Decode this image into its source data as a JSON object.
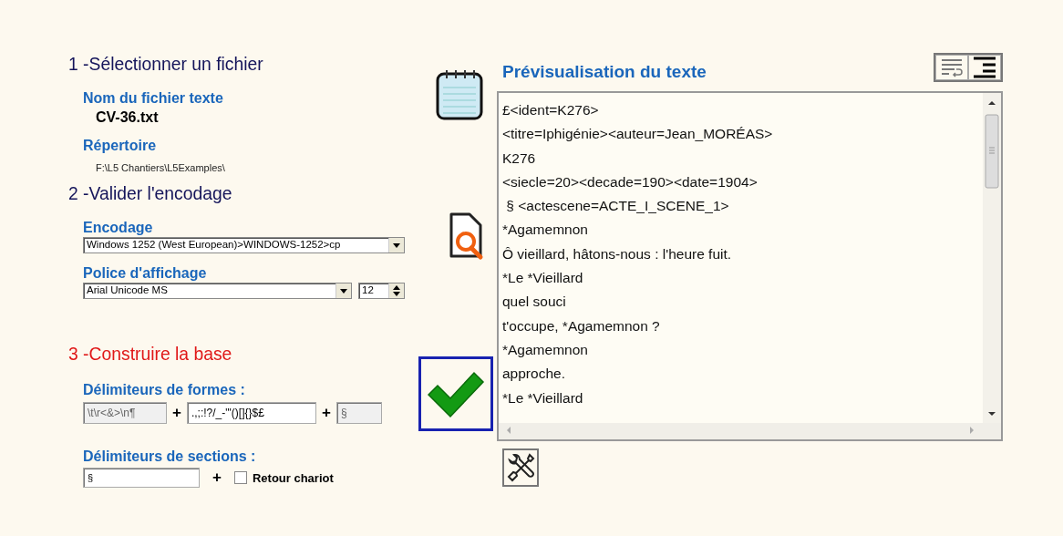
{
  "steps": [
    {
      "title": "1 -Sélectionner un fichier",
      "color": "#14145a"
    },
    {
      "title": "2 -Valider l'encodage",
      "color": "#14145a"
    },
    {
      "title": "3 -Construire la base",
      "color": "#e01818"
    }
  ],
  "file": {
    "name_label": "Nom du fichier texte",
    "name": "CV-36.txt",
    "directory_label": "Répertoire",
    "directory": "F:\\L5 Chantiers\\L5Examples\\"
  },
  "encoding": {
    "label": "Encodage",
    "value": "Windows 1252 (West European)>WINDOWS-1252>cp"
  },
  "display_font": {
    "label": "Police d'affichage",
    "value": "Arial Unicode MS",
    "size": "12"
  },
  "form_delimiters": {
    "label": "Délimiteurs de formes :",
    "joiner": "+",
    "fields": [
      {
        "value": "\\t\\r<&>\\n¶",
        "disabled": true
      },
      {
        "value": ".,;:!?/_-\"'()[]{}$£",
        "disabled": false
      },
      {
        "value": "§",
        "disabled": true
      }
    ]
  },
  "section_delimiters": {
    "label": "Délimiteurs de sections :",
    "value": "§",
    "joiner": "+",
    "carriage_return": {
      "label": "Retour chariot",
      "checked": false
    }
  },
  "preview": {
    "title": "Prévisualisation du texte",
    "lines": [
      "£<ident=K276>",
      "<titre=Iphigénie><auteur=Jean_MORÉAS>",
      "K276",
      "<siecle=20><decade=190><date=1904>",
      " § <actescene=ACTE_I_SCENE_1>",
      "*Agamemnon",
      "Ô vieillard, hâtons-nous : l'heure fuit.",
      "*Le *Vieillard",
      "quel souci",
      "t'occupe, *Agamemnon ?",
      "*Agamemnon",
      "approche.",
      "*Le *Vieillard"
    ]
  }
}
